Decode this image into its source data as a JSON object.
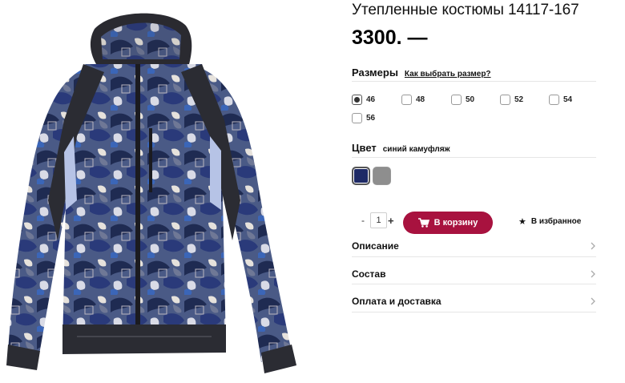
{
  "product": {
    "title": "Утепленные костюмы 14117-167",
    "price": "3300. —",
    "image_description": "jacket-photo"
  },
  "sizes": {
    "label": "Размеры",
    "guide_link": "Как выбрать размер?",
    "options": [
      {
        "value": "46",
        "selected": true
      },
      {
        "value": "48",
        "selected": false
      },
      {
        "value": "50",
        "selected": false
      },
      {
        "value": "52",
        "selected": false
      },
      {
        "value": "54",
        "selected": false
      },
      {
        "value": "56",
        "selected": false
      }
    ]
  },
  "color": {
    "label": "Цвет",
    "selected_name": "синий камуфляж",
    "swatches": [
      {
        "hex": "#1e2a66",
        "selected": true
      },
      {
        "hex": "#8e8e8e",
        "selected": false
      }
    ]
  },
  "quantity": {
    "minus": "-",
    "value": "1",
    "plus": "+"
  },
  "actions": {
    "cart_label": "В корзину",
    "favorite_label": "В избранное",
    "favorite_icon": "star-icon",
    "cart_icon": "cart-icon"
  },
  "accordion": [
    {
      "label": "Описание",
      "icon": "chevron-right-icon"
    },
    {
      "label": "Состав",
      "icon": "chevron-right-icon"
    },
    {
      "label": "Оплата и доставка",
      "icon": "chevron-right-icon"
    }
  ],
  "colors": {
    "accent": "#a8123f",
    "divider": "#e6e6e6"
  }
}
